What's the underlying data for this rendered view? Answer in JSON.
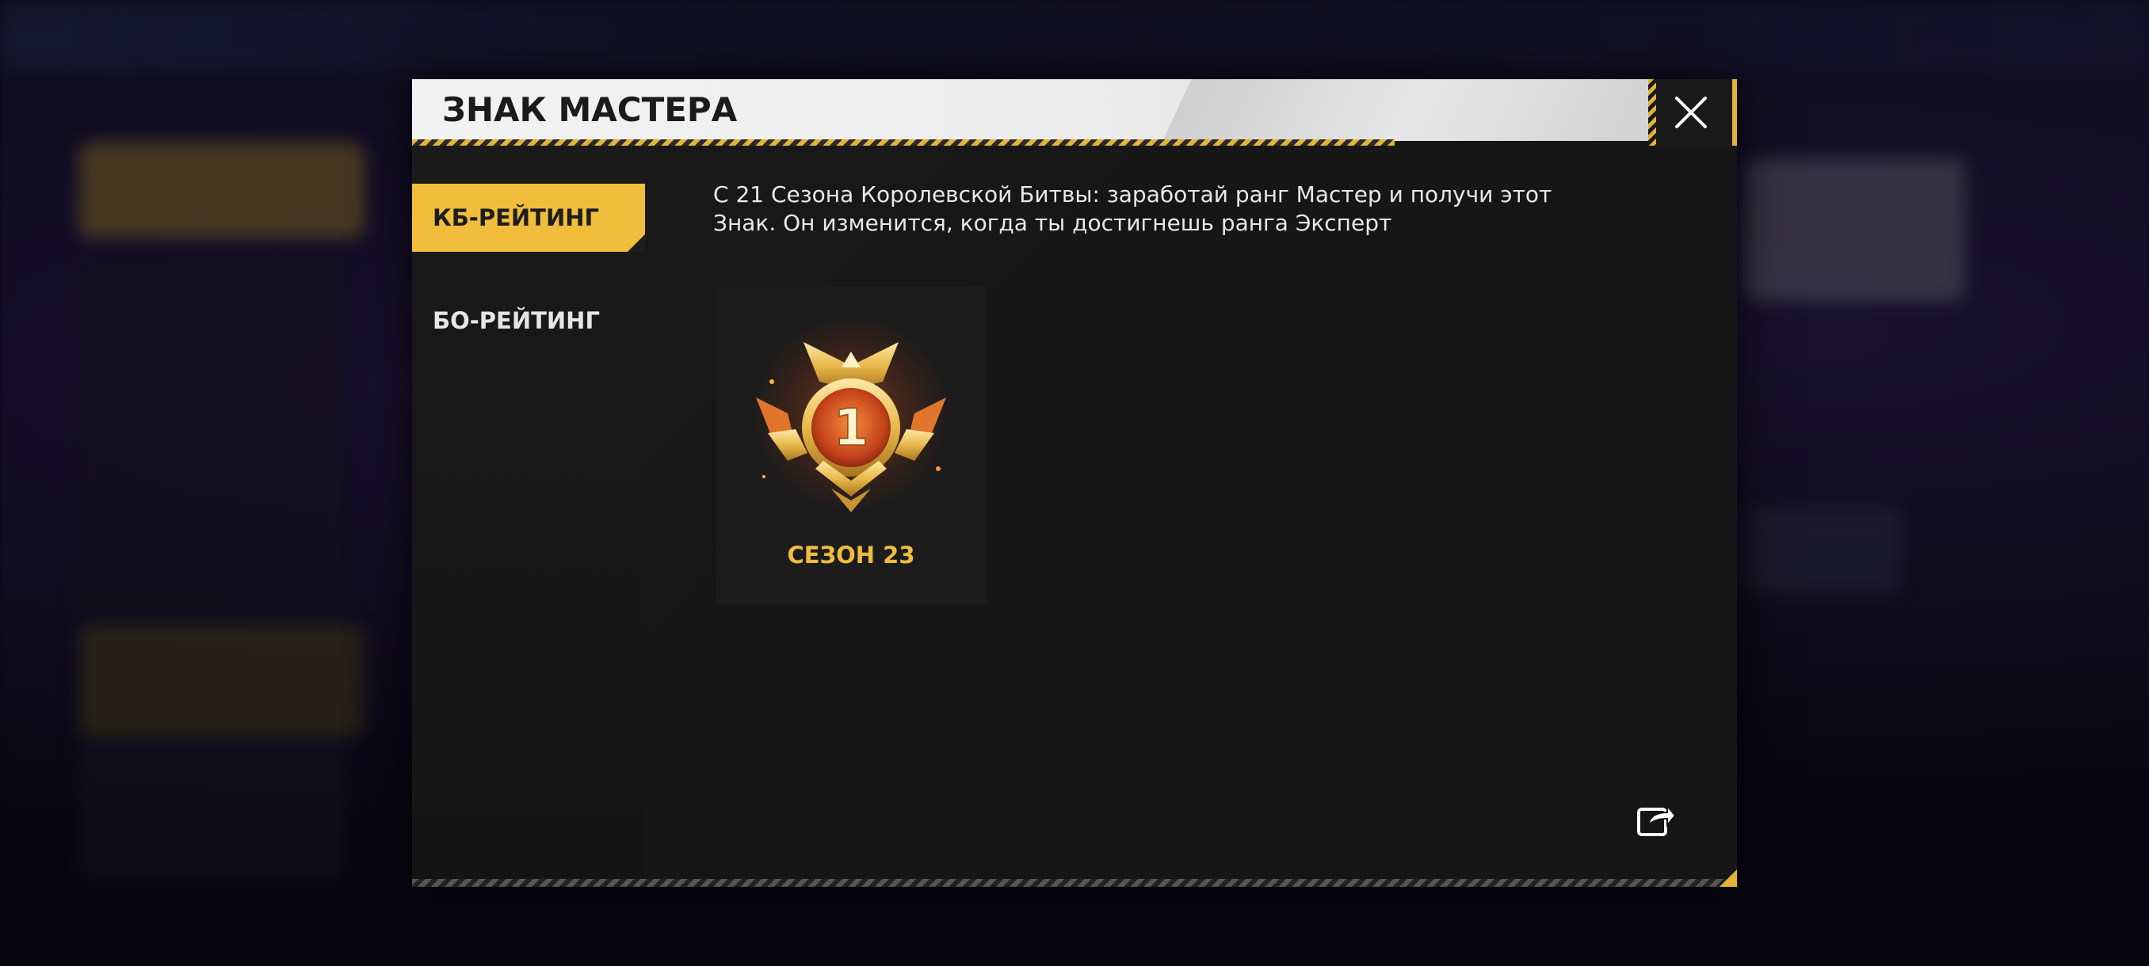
{
  "dialog": {
    "title": "ЗНАК МАСТЕРА",
    "close_icon": "close-icon",
    "share_icon": "share-icon"
  },
  "sidebar": {
    "tabs": [
      {
        "label": "КБ-РЕЙТИНГ",
        "active": true
      },
      {
        "label": "БО-РЕЙТИНГ",
        "active": false
      }
    ]
  },
  "content": {
    "description": "С 21 Сезона Королевской Битвы: заработай ранг Мастер и получи этот Знак. Он изменится, когда ты достигнешь ранга Эксперт",
    "badge": {
      "number": "1",
      "season_label": "СЕЗОН 23",
      "icon": "master-badge-icon"
    }
  },
  "colors": {
    "accent": "#f0bd3c",
    "panel": "#161616",
    "header": "#f2f2f2"
  }
}
